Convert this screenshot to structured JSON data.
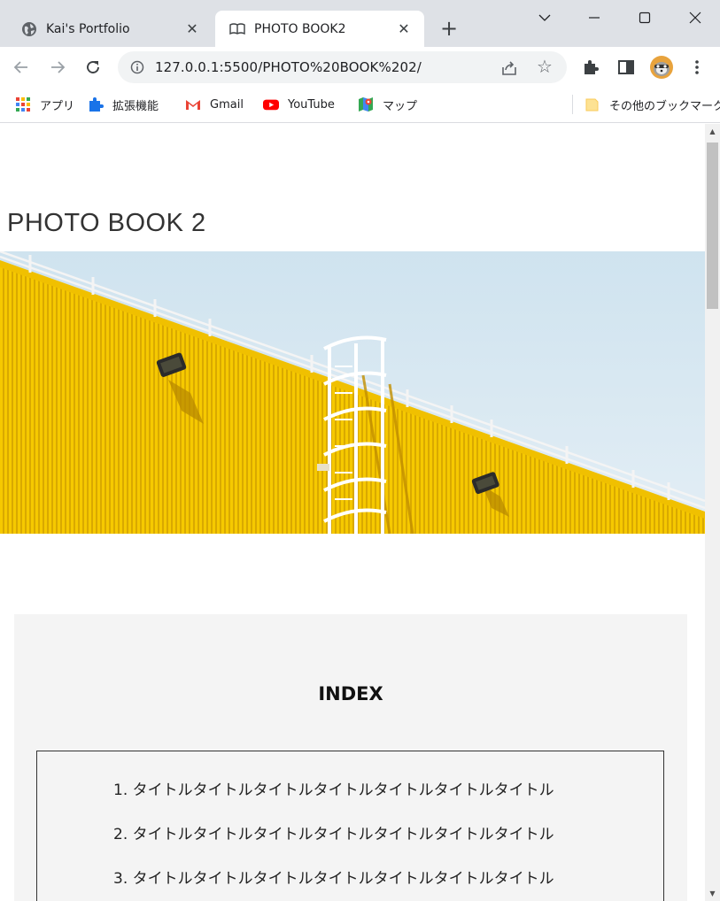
{
  "browser": {
    "tabs": [
      {
        "title": "Kai's Portfolio",
        "favicon": "globe-icon",
        "active": false
      },
      {
        "title": "PHOTO BOOK2",
        "favicon": "book-icon",
        "active": true
      }
    ],
    "url": "127.0.0.1:5500/PHOTO%20BOOK%202/",
    "bookmarks": [
      {
        "label": "アプリ",
        "icon": "apps-grid-icon"
      },
      {
        "label": "拡張機能",
        "icon": "puzzle-icon"
      },
      {
        "label": "Gmail",
        "icon": "gmail-icon"
      },
      {
        "label": "YouTube",
        "icon": "youtube-icon"
      },
      {
        "label": "マップ",
        "icon": "maps-icon"
      }
    ],
    "other_bookmarks": "その他のブックマーク"
  },
  "page": {
    "title": "PHOTO BOOK 2",
    "hero_image": "yellow-building-with-ladder-photo",
    "index": {
      "heading": "INDEX",
      "items": [
        "1. タイトルタイトルタイトルタイトルタイトルタイトルタイトル",
        "2. タイトルタイトルタイトルタイトルタイトルタイトルタイトル",
        "3. タイトルタイトルタイトルタイトルタイトルタイトルタイトル"
      ]
    }
  },
  "colors": {
    "tabstrip": "#dee1e6",
    "building_yellow": "#f5c800",
    "sky": "#d6e7f1",
    "index_bg": "#f4f4f4"
  }
}
